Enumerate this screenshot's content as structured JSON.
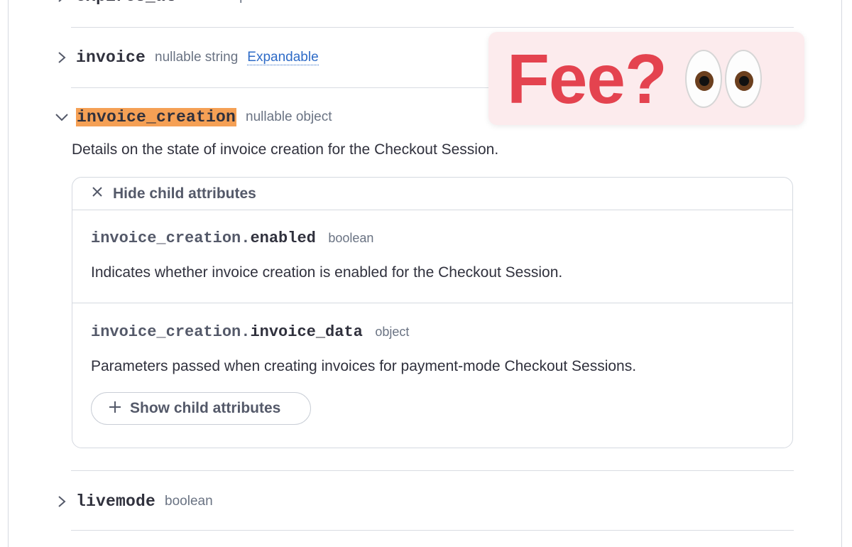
{
  "attributes": {
    "expires_at": {
      "name": "expires_at",
      "type": "timestamp"
    },
    "invoice": {
      "name": "invoice",
      "type": "nullable string",
      "expandable": "Expandable"
    },
    "invoice_creation": {
      "name": "invoice_creation",
      "type": "nullable object",
      "description": "Details on the state of invoice creation for the Checkout Session.",
      "hide_children_label": "Hide child attributes",
      "children": [
        {
          "prefix": "invoice_creation.",
          "suffix": "enabled",
          "type": "boolean",
          "description": "Indicates whether invoice creation is enabled for the Checkout Session."
        },
        {
          "prefix": "invoice_creation.",
          "suffix": "invoice_data",
          "type": "object",
          "description": "Parameters passed when creating invoices for payment-mode Checkout Sessions.",
          "show_children_label": "Show child attributes"
        }
      ]
    },
    "livemode": {
      "name": "livemode",
      "type": "boolean"
    }
  },
  "overlay": {
    "text": "Fee?",
    "emoji": "eyes",
    "text_color": "#e4434f",
    "background": "#fcebed"
  },
  "colors": {
    "highlight": "#f5a055",
    "link": "#2e6bc7"
  }
}
